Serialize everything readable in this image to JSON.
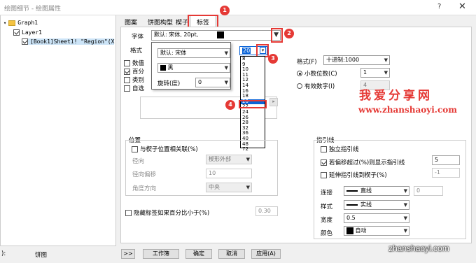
{
  "window": {
    "title": "绘图细节 - 绘图属性",
    "help": "?",
    "close": "✕"
  },
  "tree": {
    "graph": "Graph1",
    "layer": "Layer1",
    "sheet": "[Book1]Sheet1! \"Region\"(X"
  },
  "tabs": [
    "图案",
    "饼图构型",
    "楔子",
    "标签"
  ],
  "font": {
    "label": "字体",
    "value": "默认: 宋体, 20pt,"
  },
  "format": {
    "label": "格式",
    "numformat_label": "格式(F)",
    "numformat_value": "十进制:1000",
    "decimal_label": "小数位数(C)",
    "decimal_value": "1",
    "sig_label": "有效数字(I)",
    "sig_value": "4",
    "checks": [
      "数值",
      "百分",
      "类别",
      "自选"
    ]
  },
  "popup": {
    "font_value": "默认: 宋体",
    "color_value": "黑",
    "rotate_label": "旋转(度)",
    "rotate_value": "0",
    "size_value": "20"
  },
  "sizes": [
    "8",
    "9",
    "10",
    "11",
    "12",
    "14",
    "16",
    "18",
    "20",
    "22",
    "24",
    "26",
    "28",
    "32",
    "36",
    "40",
    "48",
    "72"
  ],
  "selected_size": "20",
  "position": {
    "title": "位置",
    "assoc": "与楔子位置相关联(%)",
    "radial_label": "径向",
    "radial_value": "楔形外部",
    "offset_label": "径向偏移",
    "offset_value": "10",
    "angle_label": "角度方向",
    "angle_value": "中央"
  },
  "hide": {
    "label": "隐藏标签如果百分比小于(%)",
    "value": "0.30"
  },
  "leader": {
    "title": "指引线",
    "independent": "独立指引线",
    "threshold": "若偏移超过(%)则显示指引线",
    "threshold_value": "5",
    "extend": "延伸指引线到楔子(%)",
    "extend_value": "-1",
    "connect_label": "连接",
    "connect_value": "直线",
    "connect_num": "0",
    "style_label": "样式",
    "style_value": "实线",
    "width_label": "宽度",
    "width_value": "0.5",
    "color_label": "颜色",
    "color_value": "自动"
  },
  "bottom": {
    "left_label": "):",
    "left_value": "饼图",
    "expand": ">>",
    "workbook": "工作簿",
    "ok": "确定",
    "cancel": "取消",
    "apply": "应用(A)"
  },
  "badges": [
    "1",
    "2",
    "3",
    "4"
  ],
  "watermark": {
    "cn": "我爱分享网",
    "url": "www.zhanshaoyi.com",
    "url2": "zhanshaoyi.com"
  },
  "colors": {
    "accent": "#e53935",
    "select": "#0a64d8"
  }
}
